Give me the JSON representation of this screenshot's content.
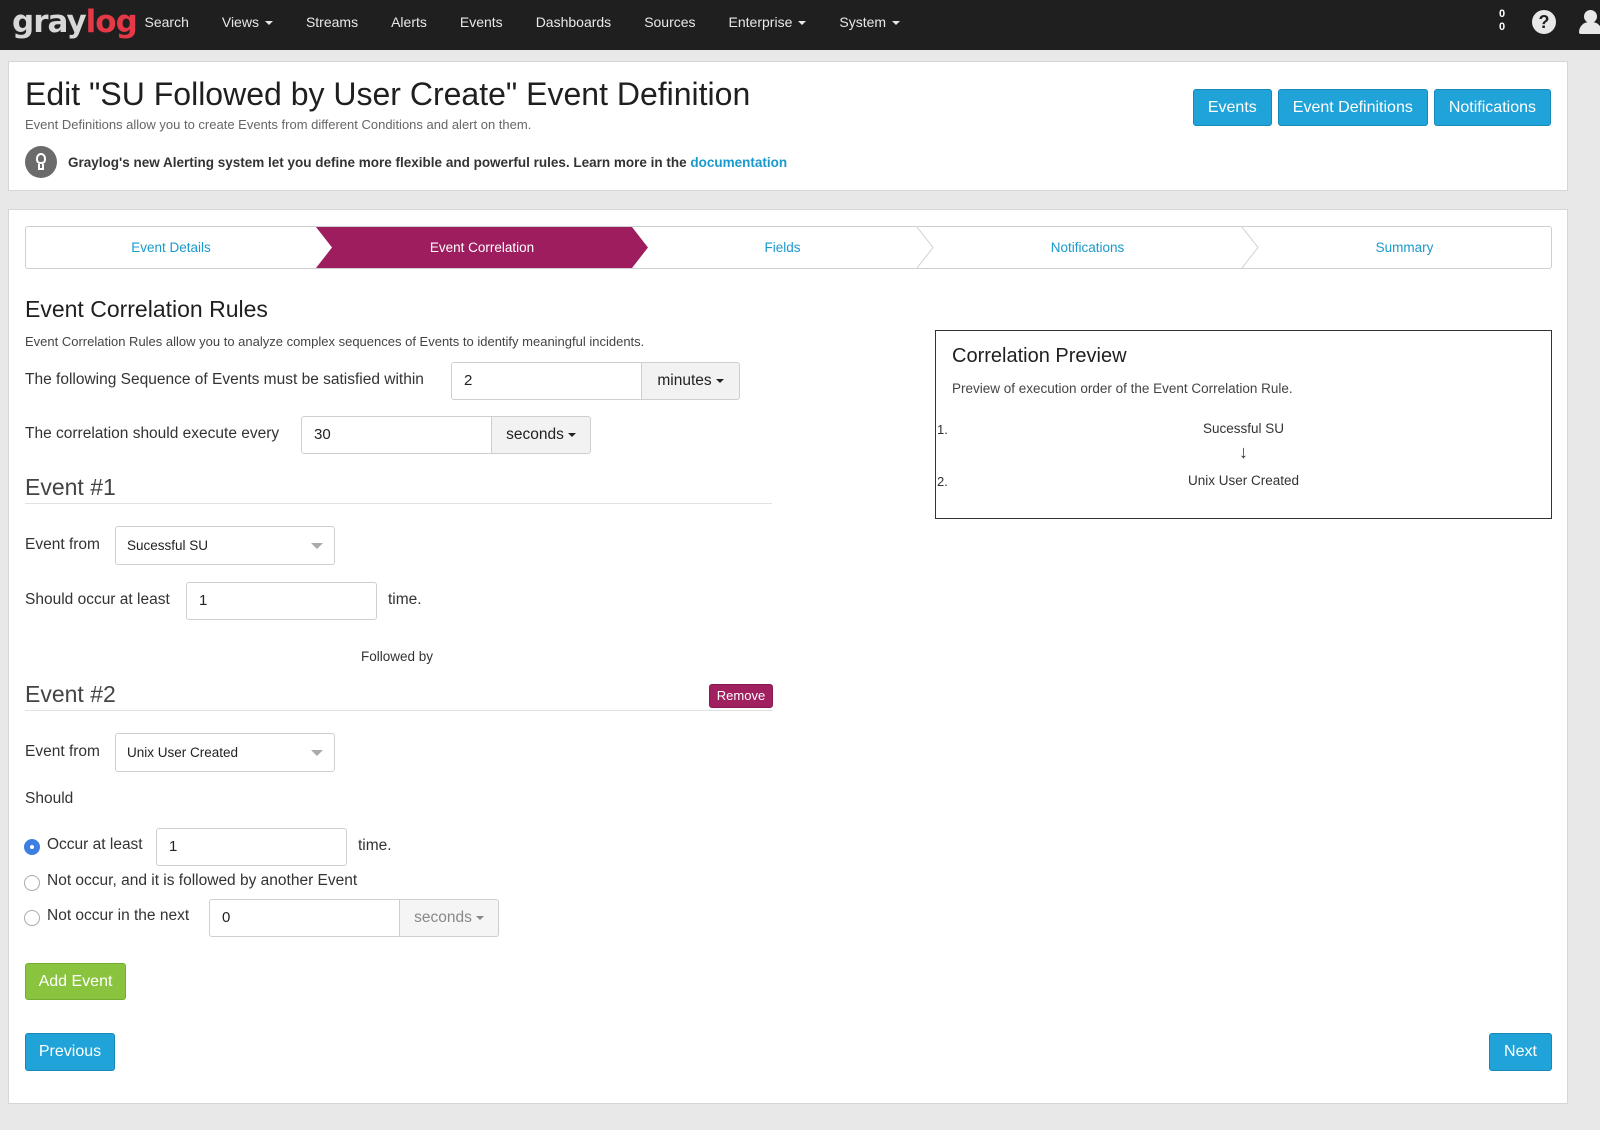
{
  "nav": {
    "logo_left": "gray",
    "logo_right": "log",
    "items": [
      {
        "label": "Search",
        "dropdown": false
      },
      {
        "label": "Views",
        "dropdown": true
      },
      {
        "label": "Streams",
        "dropdown": false
      },
      {
        "label": "Alerts",
        "dropdown": false
      },
      {
        "label": "Events",
        "dropdown": false
      },
      {
        "label": "Dashboards",
        "dropdown": false
      },
      {
        "label": "Sources",
        "dropdown": false
      },
      {
        "label": "Enterprise",
        "dropdown": true
      },
      {
        "label": "System",
        "dropdown": true
      }
    ],
    "count_top": "0",
    "count_bottom": "0",
    "help_glyph": "?"
  },
  "header": {
    "title": "Edit \"SU Followed by User Create\" Event Definition",
    "description": "Event Definitions allow you to create Events from different Conditions and alert on them.",
    "hint_text": "Graylog's new Alerting system let you define more flexible and powerful rules. Learn more in the ",
    "hint_link": "documentation",
    "buttons": {
      "events": "Events",
      "event_definitions": "Event Definitions",
      "notifications": "Notifications"
    }
  },
  "wizard": {
    "steps": [
      "Event Details",
      "Event Correlation",
      "Fields",
      "Notifications",
      "Summary"
    ],
    "active_step": 1
  },
  "correlation": {
    "title": "Event Correlation Rules",
    "description": "Event Correlation Rules allow you to analyze complex sequences of Events to identify meaningful incidents.",
    "within_label": "The following Sequence of Events must be satisfied within",
    "within_value": "2",
    "within_unit": "minutes",
    "execute_label": "The correlation should execute every",
    "execute_value": "30",
    "execute_unit": "seconds"
  },
  "event1": {
    "heading": "Event #1",
    "from_label": "Event from",
    "from_value": "Sucessful SU",
    "occur_label": "Should occur at least",
    "occur_value": "1",
    "occur_suffix": "time."
  },
  "followed_by": "Followed by",
  "event2": {
    "heading": "Event #2",
    "remove_label": "Remove",
    "from_label": "Event from",
    "from_value": "Unix User Created",
    "should_label": "Should",
    "option_occur": "Occur at least",
    "option_occur_value": "1",
    "option_occur_suffix": "time.",
    "option_not_followed": "Not occur, and it is followed by another Event",
    "option_not_next": "Not occur in the next",
    "option_not_next_value": "0",
    "option_not_next_unit": "seconds",
    "selected_option": "occur"
  },
  "actions": {
    "add_event": "Add Event",
    "previous": "Previous",
    "next": "Next"
  },
  "preview": {
    "title": "Correlation Preview",
    "description": "Preview of execution order of the Event Correlation Rule.",
    "items": [
      {
        "num": "1.",
        "name": "Sucessful SU"
      },
      {
        "num": "2.",
        "name": "Unix User Created"
      }
    ],
    "arrow": "↓"
  },
  "colors": {
    "accent": "#20a3d8",
    "wizard_active": "#9e1d5e",
    "success": "#8ac43e",
    "danger": "#a02060"
  }
}
